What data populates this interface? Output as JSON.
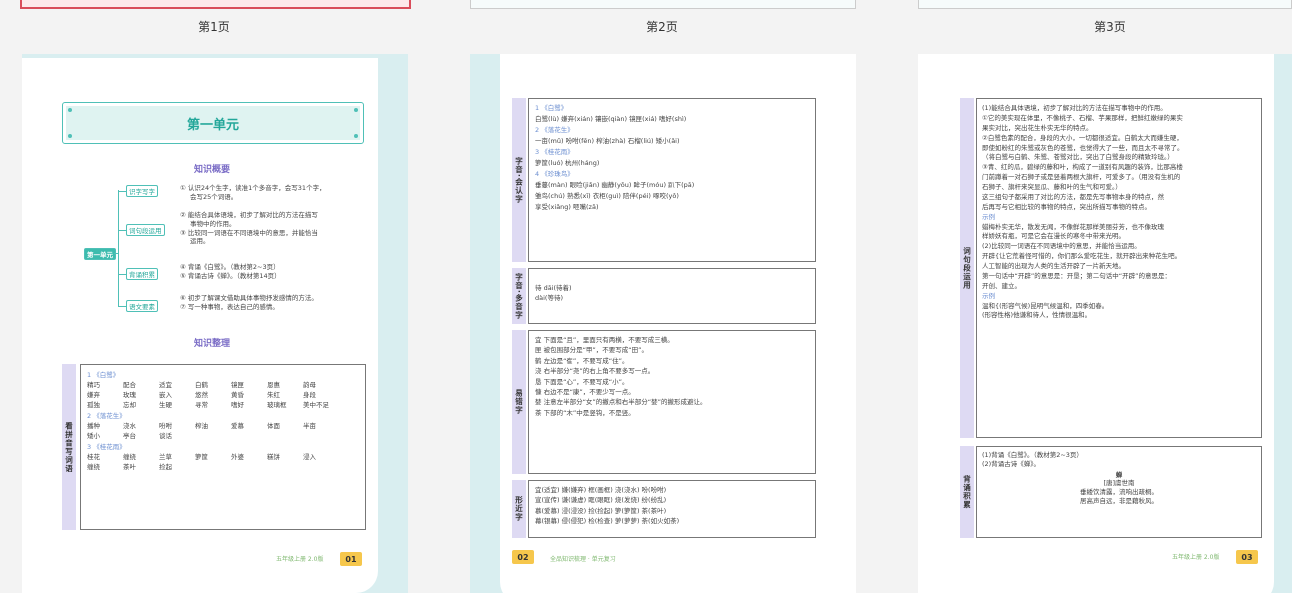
{
  "thumbnails": [
    {
      "label": "第1页"
    },
    {
      "label": "第2页"
    },
    {
      "label": "第3页"
    }
  ],
  "page1": {
    "unit_title": "第一单元",
    "overview_head": "知识概要",
    "center_tag": "第一单元",
    "branches": [
      {
        "tag": "识字写字",
        "items": [
          "① 认识24个生字，读准1个多音字，会写31个字，",
          "会写25个词语。"
        ]
      },
      {
        "tag": "词句段运用",
        "items": [
          "② 能结合具体语境，初步了解对比的方法在描写",
          "事物中的作用。",
          "③ 比较同一词语在不同语境中的意思，并能恰当",
          "运用。"
        ]
      },
      {
        "tag": "背诵积累",
        "items": [
          "④ 背诵《白鹭》。（教材第2~3页）",
          "⑤ 背诵古诗《蝉》。（教材第14页）"
        ]
      },
      {
        "tag": "语文要素",
        "items": [
          "⑥ 初步了解课文借助具体事物抒发感情的方法。",
          "⑦ 写一种事物，表达自己的感情。"
        ]
      }
    ],
    "sort_head": "知识整理",
    "side_label": "看拼音写词语",
    "groups": [
      {
        "title": "1 《白鹭》",
        "rows": [
          [
            "精巧",
            "配合",
            "适宜",
            "白鹤",
            "镜匣",
            "恩惠",
            "韵母"
          ],
          [
            "嫌弃",
            "玫瑰",
            "嵌入",
            "悠然",
            "黄昏",
            "朱红",
            "身段"
          ],
          [
            "孤独",
            "忘却",
            "生硬",
            "寻常",
            "嗜好",
            "玻璃框",
            "美中不足"
          ]
        ]
      },
      {
        "title": "2 《落花生》",
        "rows": [
          [
            "播种",
            "浇水",
            "吩咐",
            "榨油",
            "爱慕",
            "体面",
            "半亩"
          ],
          [
            "矮小",
            "亭台",
            "谈话"
          ]
        ]
      },
      {
        "title": "3 《桂花雨》",
        "rows": [
          [
            "桂花",
            "缠绕",
            "兰草",
            "箩筐",
            "外婆",
            "糕饼",
            "浸入"
          ],
          [
            "缠绕",
            "茶叶",
            "捡起"
          ]
        ]
      }
    ],
    "footer_grade": "五年级上册  2.0版",
    "page_no": "01"
  },
  "page2": {
    "sections": [
      {
        "label": "字音·会认字",
        "lines": [
          {
            "t": "1 《白鹭》",
            "c": "blue"
          },
          {
            "t": "白鹭(lù)      嫌弃(xián)      镶嵌(qiàn)      镜匣(xiá)      嗜好(shì)"
          },
          {
            "t": "2 《落花生》",
            "c": "blue"
          },
          {
            "t": "一亩(mǔ)      吩咐(fēn)      榨油(zhà)      石榴(liú)      矮小(ǎi)"
          },
          {
            "t": "3 《桂花雨》",
            "c": "blue"
          },
          {
            "t": "箩筐(luó)      杭州(háng)"
          },
          {
            "t": "4 《珍珠鸟》",
            "c": "blue"
          },
          {
            "t": "垂蔓(màn)   眼睑(jiǎn)   幽静(yōu)   眸子(móu)   趴下(pā)"
          },
          {
            "t": "雏鸟(chú)   熟悉(xī)   衣柜(guì)   陪伴(péi)   啄咬(yǒ)"
          },
          {
            "t": "享受(xiǎng)   咂嘴(zā)"
          }
        ]
      },
      {
        "label": "字音·多音字",
        "lines": [
          {
            "t": "待 dāi(待着)"
          },
          {
            "t": "   dài(等待)"
          }
        ]
      },
      {
        "label": "易错字",
        "lines": [
          {
            "t": "宜   下面是“且”，里面只有两横，不要写成三横。"
          },
          {
            "t": "匣   被包围部分是“甲”，不要写成“田”。"
          },
          {
            "t": "鹤   左边是“隺”，不要写成“住”。"
          },
          {
            "t": "浇   右半部分“尧”的右上角不要多写一点。"
          },
          {
            "t": "恳   下面是“心”，不要写成“小”。"
          },
          {
            "t": "慷   右边不是“康”，不要少写一点。"
          },
          {
            "t": "婪   注意左半部分“女”的撇点和右半部分“婪”的撇形成避让。"
          },
          {
            "t": "茶   下部的“木”中是竖钩，不是竖。"
          }
        ]
      },
      {
        "label": "形近字",
        "lines": [
          {
            "t": "宜(适宜)  嫌(嫌弃)  框(画框)  浇(浇水)  吩(吩咐)"
          },
          {
            "t": "宣(宣传)  谦(谦虚)  眶(眼眶)  烧(发烧)  纷(纷乱)"
          },
          {
            "t": "慕(爱慕)  浸(浸没)  捡(捡起)  箩(箩筐)  茶(茶叶)"
          },
          {
            "t": "幕(银幕)  侵(侵犯)  检(检查)  萝(萝萝)  荼(如火如荼)"
          }
        ]
      }
    ],
    "page_no": "02",
    "footer_title": "全品知识梳理 · 单元复习"
  },
  "page3": {
    "sec1_label": "词句段运用",
    "sec1_lines": [
      "(1)能结合具体语境，初步了解对比的方法在描写事物中的作用。",
      "    ①它的美实现在体里，不像桃子、石榴、芋果那样，把鲜红嫩绿的果实",
      "果实对比，突出花生朴实无华的特点。",
      "    ②白鹭色素的配合，身段的大小，一切都很适宜。白鹤太大而嫌生硬，",
      "即使如粉红的朱鹭或灰色的苍鹭，也觉得大了一些，而且太不寻常了。",
      "（将白鹭与白鹤、朱鹭、苍鹭对比，突出了白鹭身段的精致玲珑。）",
      "    ③青、红的瓜，碧绿的藤和叶，构成了一道别有风趣的装饰，比那高楼",
      "门前蹲着一对石狮子或是竖着两根大旗杆，可爱多了。（用没有生机的",
      "石狮子、旗杆来突显瓜、藤和叶的生气和可爱。）",
      "    这三组句子都采用了对比的方法，都是先写事物本身的特点，然",
      "后再写与它相比较的事物的特点，突出所描写事物的特点。",
      "示例",
      "    蜡梅朴实无华，散发无闻，不像鲜花那样美丽芬芳，也不像玫瑰",
      "样娇妖有瓶，可是它会在漫长的寒冬中带来光明。",
      "(2)比较同一词语在不同语境中的意思，并能恰当运用。",
      "开辟{让它荒着怪可惜的，你们那么爱吃花生，就开辟出来种花生吧。",
      "     人工智能的出现为人类的生活开辟了一片新天地。",
      "    第一句话中“开辟”的意思是：开垦；第二句话中“开辟”的意思是：",
      "开创、建立。",
      "示例",
      "    温和{(形容气候)昆明气候温和，四季如春。",
      "         (形容性格)他谦和待人，性情很温和。"
    ],
    "sec2_label": "背诵积累",
    "sec2_lines": [
      "(1)背诵《白鹭》。（教材第2~3页）",
      "(2)背诵古诗《蝉》。"
    ],
    "poem_title": "蝉",
    "poem_author": "[唐]虞世南",
    "poem_lines": [
      "垂緌饮清露，流响出疏桐。",
      "居高声自远，非是藉秋风。"
    ],
    "footer_grade": "五年级上册  2.0版",
    "page_no": "03"
  }
}
